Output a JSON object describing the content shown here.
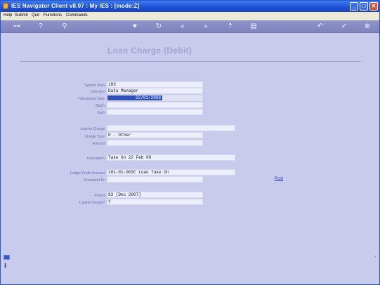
{
  "window": {
    "title": "IES Navigator Client v8.07 : My IES :     [mode:Z]",
    "controls": [
      "minimize-icon",
      "maximize-icon",
      "close-icon"
    ]
  },
  "menu": {
    "items": [
      "Help",
      "Submit",
      "Quit",
      "Functions",
      "Commands"
    ]
  },
  "toolbar": {
    "icons": [
      "key-icon",
      "help-icon",
      "search-icon",
      "heart-icon",
      "refresh-icon",
      "rewind-icon",
      "fast-forward-icon",
      "upload-icon",
      "list-icon",
      "back-icon",
      "check-icon",
      "cancel-icon"
    ],
    "glyphs": {
      "key": "⊶",
      "help": "?",
      "search": "⚲",
      "heart": "♥",
      "refresh": "↻",
      "rewind": "«",
      "forward": "»",
      "upload": "⇡",
      "list": "▤",
      "back": "↶",
      "check": "✓",
      "cancel": "⊗"
    }
  },
  "page": {
    "heading": "Loan Charge (Debit)",
    "post_link": "Post"
  },
  "form": {
    "system_num": {
      "label": "System Num",
      "value": "183"
    },
    "operator": {
      "label": "Operator",
      "value": "Data Manager"
    },
    "transaction_date": {
      "label": "Transaction Date",
      "value": "22/01/2008"
    },
    "batch": {
      "label": "Batch",
      "value": ""
    },
    "auth": {
      "label": "Auth",
      "value": ""
    },
    "loan_to_charge": {
      "label": "Loan to Charge",
      "value": ""
    },
    "charge_type": {
      "label": "Charge Type",
      "value": "0 - Other"
    },
    "amount": {
      "label": "Amount",
      "value": ""
    },
    "description": {
      "label": "Description",
      "value": "Take On 22 Feb 08"
    },
    "ledger_credit_account": {
      "label": "Ledger Credit Account",
      "value": "101-01-003C Loan Take On"
    },
    "document_nr": {
      "label": "Document Nr",
      "value": ""
    },
    "period": {
      "label": "Period",
      "value": "83  [Dec 2007]"
    },
    "capital_charge": {
      "label": "Capital Charge?",
      "value": "Y"
    }
  },
  "colors": {
    "background": "#c8cbec",
    "titlebar": "#1c4fd6",
    "selection": "#2f50b8",
    "link": "#1d3fc0"
  }
}
